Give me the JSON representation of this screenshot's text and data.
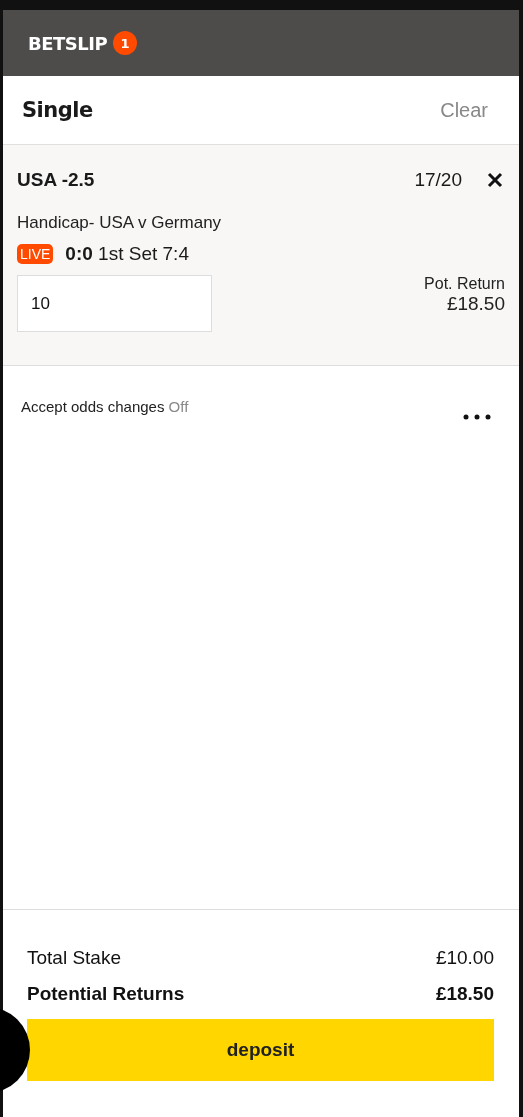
{
  "header": {
    "title": "BETSLIP",
    "count": "1"
  },
  "section": {
    "title": "Single",
    "clear": "Clear"
  },
  "bet": {
    "selection": "USA -2.5",
    "odds": "17/20",
    "market": "Handicap- USA v Germany",
    "live": true,
    "live_label": "LIVE",
    "score": "0:0",
    "period": "1st Set 7:4",
    "stake": "10",
    "return_label": "Pot. Return",
    "return_value": "£18.50"
  },
  "odds_changes": {
    "label": "Accept odds changes",
    "value": "Off",
    "on": false
  },
  "totals": [
    {
      "label": "Total Stake",
      "value": "£10.00",
      "kind": "normal"
    },
    {
      "label": "Potential Returns",
      "value": "£18.50",
      "kind": "strong"
    }
  ],
  "deposit": "deposit"
}
